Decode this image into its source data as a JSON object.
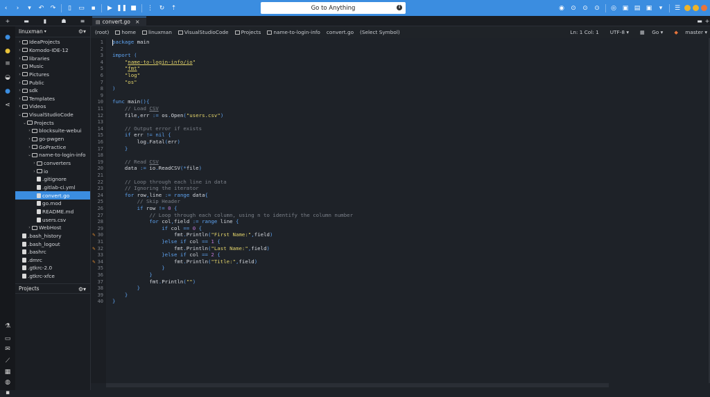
{
  "toolbar": {
    "goto_placeholder": "Go to Anything",
    "info_glyph": "i"
  },
  "tabs": {
    "file_tab_label": "convert.go",
    "file_tab_close": "×"
  },
  "tree": {
    "root_label": "linuxman",
    "rows": [
      {
        "label": "IdeaProjects",
        "kind": "folder",
        "depth": 0,
        "chev": "›"
      },
      {
        "label": "Komodo-IDE-12",
        "kind": "folder",
        "depth": 0,
        "chev": "›"
      },
      {
        "label": "libraries",
        "kind": "folder",
        "depth": 0,
        "chev": "›"
      },
      {
        "label": "Music",
        "kind": "folder",
        "depth": 0,
        "chev": "›"
      },
      {
        "label": "Pictures",
        "kind": "folder",
        "depth": 0,
        "chev": "›"
      },
      {
        "label": "Public",
        "kind": "folder",
        "depth": 0,
        "chev": "›"
      },
      {
        "label": "sdk",
        "kind": "folder",
        "depth": 0,
        "chev": "›"
      },
      {
        "label": "Templates",
        "kind": "folder",
        "depth": 0,
        "chev": "›"
      },
      {
        "label": "Videos",
        "kind": "folder",
        "depth": 0,
        "chev": "›"
      },
      {
        "label": "VisualStudioCode",
        "kind": "folder",
        "depth": 0,
        "chev": "⌄"
      },
      {
        "label": "Projects",
        "kind": "folder",
        "depth": 1,
        "chev": "⌄"
      },
      {
        "label": "blocksuite-webui",
        "kind": "folder",
        "depth": 2,
        "chev": "›"
      },
      {
        "label": "go-pwgen",
        "kind": "folder",
        "depth": 2,
        "chev": "›"
      },
      {
        "label": "GoPractice",
        "kind": "folder",
        "depth": 2,
        "chev": "›"
      },
      {
        "label": "name-to-login-info",
        "kind": "folder",
        "depth": 2,
        "chev": "⌄"
      },
      {
        "label": "converters",
        "kind": "folder",
        "depth": 3,
        "chev": "›"
      },
      {
        "label": "io",
        "kind": "folder",
        "depth": 3,
        "chev": "›"
      },
      {
        "label": ".gitignore",
        "kind": "file",
        "depth": 3,
        "chev": ""
      },
      {
        "label": ".gitlab-ci.yml",
        "kind": "file",
        "depth": 3,
        "chev": ""
      },
      {
        "label": "convert.go",
        "kind": "file",
        "depth": 3,
        "chev": "",
        "selected": true
      },
      {
        "label": "go.mod",
        "kind": "file",
        "depth": 3,
        "chev": ""
      },
      {
        "label": "README.md",
        "kind": "file",
        "depth": 3,
        "chev": ""
      },
      {
        "label": "users.csv",
        "kind": "file",
        "depth": 3,
        "chev": ""
      },
      {
        "label": "WebHost",
        "kind": "folder",
        "depth": 2,
        "chev": "›"
      },
      {
        "label": ".bash_history",
        "kind": "file",
        "depth": 0,
        "chev": ""
      },
      {
        "label": ".bash_logout",
        "kind": "file",
        "depth": 0,
        "chev": ""
      },
      {
        "label": ".bashrc",
        "kind": "file",
        "depth": 0,
        "chev": ""
      },
      {
        "label": ".dmrc",
        "kind": "file",
        "depth": 0,
        "chev": ""
      },
      {
        "label": ".gtkrc-2.0",
        "kind": "file",
        "depth": 0,
        "chev": ""
      },
      {
        "label": ".gtkrc-xfce",
        "kind": "file",
        "depth": 0,
        "chev": ""
      }
    ],
    "projects_label": "Projects"
  },
  "breadcrumbs": [
    "(root)",
    "home",
    "linuxman",
    "VisualStudioCode",
    "Projects",
    "name-to-login-info",
    "convert.go",
    "(Select Symbol)"
  ],
  "status": {
    "position": "Ln: 1 Col: 1",
    "encoding": "UTF-8",
    "language": "Go",
    "branch": "master"
  },
  "editor": {
    "lines": [
      [
        [
          "kw",
          "package"
        ],
        [
          "t",
          " main"
        ]
      ],
      [],
      [
        [
          "kw",
          "import"
        ],
        [
          "t",
          " "
        ],
        [
          "pun",
          "("
        ]
      ],
      [
        [
          "t",
          "    "
        ],
        [
          "str",
          "\""
        ],
        [
          "str und",
          "name-to-login-info/io"
        ],
        [
          "str",
          "\""
        ]
      ],
      [
        [
          "t",
          "    "
        ],
        [
          "str",
          "\""
        ],
        [
          "str und",
          "fmt"
        ],
        [
          "str",
          "\""
        ]
      ],
      [
        [
          "t",
          "    "
        ],
        [
          "str",
          "\"log\""
        ]
      ],
      [
        [
          "t",
          "    "
        ],
        [
          "str",
          "\"os\""
        ]
      ],
      [
        [
          "pun",
          ")"
        ]
      ],
      [],
      [
        [
          "kw",
          "func"
        ],
        [
          "t",
          " main"
        ],
        [
          "pun",
          "(){"
        ]
      ],
      [
        [
          "t",
          "    "
        ],
        [
          "com",
          "// Load "
        ],
        [
          "com und",
          "CSV"
        ]
      ],
      [
        [
          "t",
          "    file"
        ],
        [
          "pun",
          ","
        ],
        [
          "t",
          "err "
        ],
        [
          "pun",
          ":="
        ],
        [
          "t",
          " os"
        ],
        [
          "pun",
          "."
        ],
        [
          "t",
          "Open"
        ],
        [
          "pun",
          "("
        ],
        [
          "str",
          "\"users.csv\""
        ],
        [
          "pun",
          ")"
        ]
      ],
      [],
      [
        [
          "t",
          "    "
        ],
        [
          "com",
          "// Output error if exists"
        ]
      ],
      [
        [
          "t",
          "    "
        ],
        [
          "kw",
          "if"
        ],
        [
          "t",
          " err "
        ],
        [
          "pun",
          "!="
        ],
        [
          "t",
          " "
        ],
        [
          "kw",
          "nil"
        ],
        [
          "t",
          " "
        ],
        [
          "pun",
          "{"
        ]
      ],
      [
        [
          "t",
          "        log"
        ],
        [
          "pun",
          "."
        ],
        [
          "t",
          "Fatal"
        ],
        [
          "pun",
          "("
        ],
        [
          "t",
          "err"
        ],
        [
          "pun",
          ")"
        ]
      ],
      [
        [
          "t",
          "    "
        ],
        [
          "pun",
          "}"
        ]
      ],
      [],
      [
        [
          "t",
          "    "
        ],
        [
          "com",
          "// Read "
        ],
        [
          "com und",
          "CSV"
        ]
      ],
      [
        [
          "t",
          "    data "
        ],
        [
          "pun",
          ":="
        ],
        [
          "t",
          " io"
        ],
        [
          "pun",
          "."
        ],
        [
          "t",
          "ReadCSV"
        ],
        [
          "pun",
          "(*"
        ],
        [
          "t",
          "file"
        ],
        [
          "pun",
          ")"
        ]
      ],
      [],
      [
        [
          "t",
          "    "
        ],
        [
          "com",
          "// Loop through each line in data"
        ]
      ],
      [
        [
          "t",
          "    "
        ],
        [
          "com",
          "// Ignoring the iterator"
        ]
      ],
      [
        [
          "t",
          "    "
        ],
        [
          "kw",
          "for"
        ],
        [
          "t",
          " row"
        ],
        [
          "pun",
          ","
        ],
        [
          "t",
          "line "
        ],
        [
          "pun",
          ":="
        ],
        [
          "t",
          " "
        ],
        [
          "kw",
          "range"
        ],
        [
          "t",
          " data"
        ],
        [
          "pun",
          "{"
        ]
      ],
      [
        [
          "t",
          "        "
        ],
        [
          "com",
          "// Skip Header"
        ]
      ],
      [
        [
          "t",
          "        "
        ],
        [
          "kw",
          "if"
        ],
        [
          "t",
          " row "
        ],
        [
          "pun",
          "!="
        ],
        [
          "t",
          " "
        ],
        [
          "num",
          "0"
        ],
        [
          "t",
          " "
        ],
        [
          "pun",
          "{"
        ]
      ],
      [
        [
          "t",
          "            "
        ],
        [
          "com",
          "// Loop through each column, using n to identify the column number"
        ]
      ],
      [
        [
          "t",
          "            "
        ],
        [
          "kw",
          "for"
        ],
        [
          "t",
          " col"
        ],
        [
          "pun",
          ","
        ],
        [
          "t",
          "field "
        ],
        [
          "pun",
          ":="
        ],
        [
          "t",
          " "
        ],
        [
          "kw",
          "range"
        ],
        [
          "t",
          " line "
        ],
        [
          "pun",
          "{"
        ]
      ],
      [
        [
          "t",
          "                "
        ],
        [
          "kw",
          "if"
        ],
        [
          "t",
          " col "
        ],
        [
          "pun",
          "=="
        ],
        [
          "t",
          " "
        ],
        [
          "num",
          "0"
        ],
        [
          "t",
          " "
        ],
        [
          "pun",
          "{"
        ]
      ],
      [
        [
          "t",
          "                    fmt"
        ],
        [
          "pun",
          "."
        ],
        [
          "t",
          "Println"
        ],
        [
          "pun",
          "("
        ],
        [
          "str",
          "\"First Name:\""
        ],
        [
          "pun",
          ","
        ],
        [
          "t",
          "field"
        ],
        [
          "pun",
          ")"
        ]
      ],
      [
        [
          "t",
          "                "
        ],
        [
          "pun",
          "}"
        ],
        [
          "kw",
          "else if"
        ],
        [
          "t",
          " col "
        ],
        [
          "pun",
          "=="
        ],
        [
          "t",
          " "
        ],
        [
          "num",
          "1"
        ],
        [
          "t",
          " "
        ],
        [
          "pun",
          "{"
        ]
      ],
      [
        [
          "t",
          "                    fmt"
        ],
        [
          "pun",
          "."
        ],
        [
          "t",
          "Println"
        ],
        [
          "pun",
          "("
        ],
        [
          "str",
          "\"Last Name:\""
        ],
        [
          "pun",
          ","
        ],
        [
          "t",
          "field"
        ],
        [
          "pun",
          ")"
        ]
      ],
      [
        [
          "t",
          "                "
        ],
        [
          "pun",
          "}"
        ],
        [
          "kw",
          "else if"
        ],
        [
          "t",
          " col "
        ],
        [
          "pun",
          "=="
        ],
        [
          "t",
          " "
        ],
        [
          "num",
          "2"
        ],
        [
          "t",
          " "
        ],
        [
          "pun",
          "{"
        ]
      ],
      [
        [
          "t",
          "                    fmt"
        ],
        [
          "pun",
          "."
        ],
        [
          "t",
          "Println"
        ],
        [
          "pun",
          "("
        ],
        [
          "str",
          "\"Title:\""
        ],
        [
          "pun",
          ","
        ],
        [
          "t",
          "field"
        ],
        [
          "pun",
          ")"
        ]
      ],
      [
        [
          "t",
          "                "
        ],
        [
          "pun",
          "}"
        ]
      ],
      [
        [
          "t",
          "            "
        ],
        [
          "pun",
          "}"
        ]
      ],
      [
        [
          "t",
          "            fmt"
        ],
        [
          "pun",
          "."
        ],
        [
          "t",
          "Println"
        ],
        [
          "pun",
          "("
        ],
        [
          "str",
          "\"\""
        ],
        [
          "pun",
          ")"
        ]
      ],
      [
        [
          "t",
          "        "
        ],
        [
          "pun",
          "}"
        ]
      ],
      [
        [
          "t",
          "    "
        ],
        [
          "pun",
          "}"
        ]
      ],
      [
        [
          "pun",
          "}"
        ]
      ]
    ],
    "marked_lines": [
      30,
      32,
      34
    ]
  }
}
